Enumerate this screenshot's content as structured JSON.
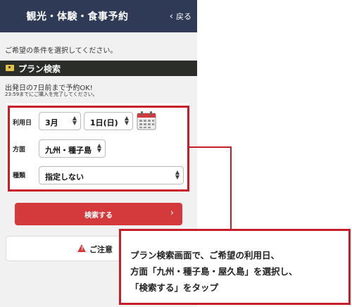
{
  "header": {
    "title": "観光・体験・食事予約",
    "back_label": "戻る"
  },
  "prompt": "ご希望の条件を選択してください。",
  "section": {
    "title": "プラン検索",
    "icon": "camera-icon"
  },
  "notice": {
    "line1": "出発日の7日前まで予約OK!",
    "line2": "23:59までにご購入を完了してください。"
  },
  "form": {
    "date_label": "利用日",
    "month_value": "3月",
    "day_value": "1日(日)",
    "area_label": "方面",
    "area_value": "九州・種子島",
    "type_label": "種類",
    "type_value": "指定しない"
  },
  "search_button": {
    "label": "検索する",
    "icon": "chevron-right-icon"
  },
  "caution_button": {
    "label": "ご注意",
    "icon": "warning-icon"
  },
  "callout": {
    "line1": "プラン検索画面で、ご希望の利用日、",
    "line2": "方面「九州・種子島・屋久島」を選択し、",
    "line3": "「検索する」をタップ"
  },
  "colors": {
    "header": "#2e3a56",
    "section_bar": "#2b2d29",
    "accent": "#d43a3c",
    "highlight": "#c81d28"
  }
}
